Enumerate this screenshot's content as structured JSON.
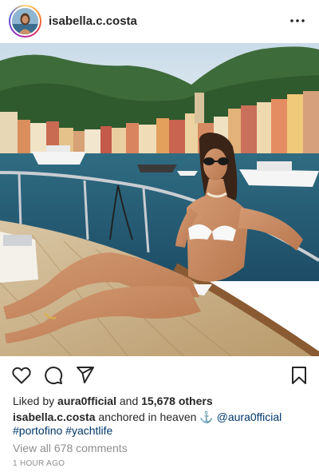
{
  "post": {
    "username": "isabella.c.costa",
    "more_icon": "more-horizontal-icon"
  },
  "image": {
    "description_icon": "photo-woman-on-yacht"
  },
  "actions": {
    "like_icon": "heart-icon",
    "comment_icon": "comment-icon",
    "share_icon": "paper-plane-icon",
    "save_icon": "bookmark-icon"
  },
  "likes": {
    "prefix": "Liked by",
    "user": "aura0fficial",
    "connector": "and",
    "others": "15,678 others"
  },
  "caption": {
    "username": "isabella.c.costa",
    "text": "anchored in heaven",
    "emoji": "⚓",
    "mention": "@aura0fficial",
    "hashtags": [
      "#portofino",
      "#yachtlife"
    ]
  },
  "comments": {
    "label": "View all 678 comments"
  },
  "timestamp": "1 HOUR AGO",
  "colors": {
    "link": "#00376b",
    "muted": "#8e8e8e",
    "text": "#262626"
  }
}
